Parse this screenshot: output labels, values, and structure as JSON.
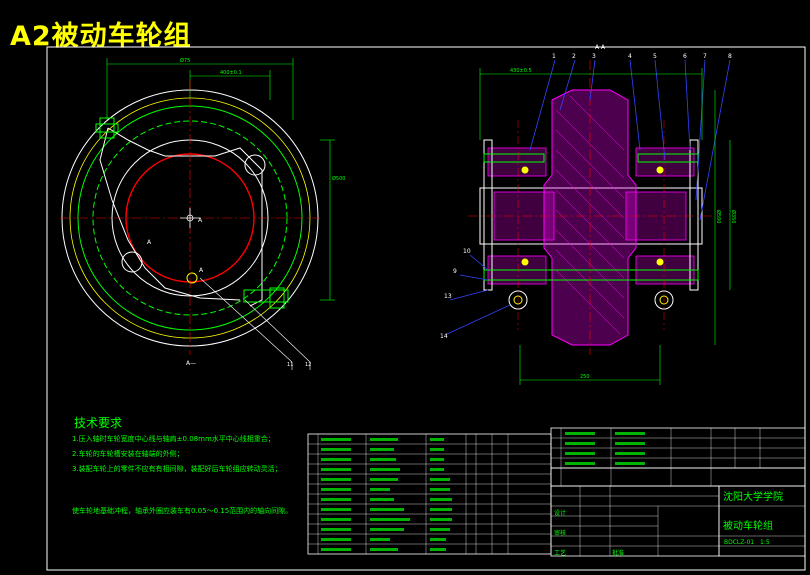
{
  "title": "A2被动车轮组",
  "section_label": "A-A",
  "tech_requirements": {
    "heading": "技术要求",
    "items": [
      "1.压入轴时车轮宽度中心线与轴肩±0.08mm水平中心线相重合；",
      "2.车轮的车轮槽安装在轴端的外侧；",
      "3.装配车轮上的零件不应有有相间隙，装配好后车轮组应转动灵活；",
      "使车轮地基础冲程，轴承外圈应装车有0.05～0.15范围内的轴向间隙。"
    ]
  },
  "title_block": {
    "school": "沈阳大学学院",
    "drawing_name": "被动车轮组",
    "drawing_number": "BDCLZ-01",
    "designed_by": "设计",
    "checked_by": "审核",
    "process": "工艺",
    "approved": "批准",
    "scale": "1:5"
  },
  "colors": {
    "background": "#000000",
    "outline": "#ffffff",
    "green": "#00ff00",
    "red": "#ff0000",
    "magenta": "#ff00ff",
    "blue": "#3344ff",
    "yellow": "#ffff00",
    "cyan": "#00e5ff"
  }
}
